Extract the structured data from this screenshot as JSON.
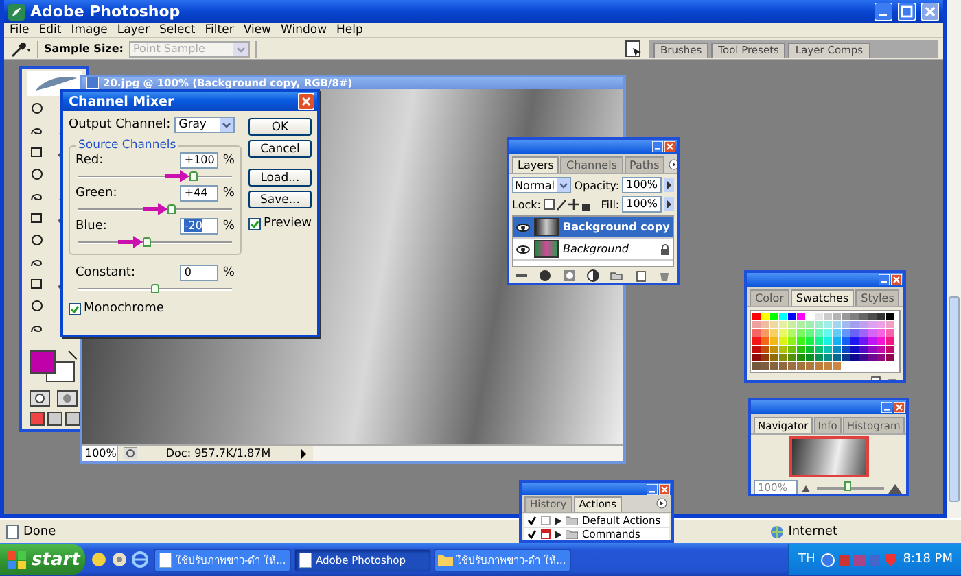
{
  "window": {
    "title": "Adobe Photoshop"
  },
  "menu": [
    "File",
    "Edit",
    "Image",
    "Layer",
    "Select",
    "Filter",
    "View",
    "Window",
    "Help"
  ],
  "options_bar": {
    "sample_size_label": "Sample Size:",
    "sample_size": {
      "value": "Point Sample",
      "disabled": true
    },
    "palette_well_tabs": [
      "Brushes",
      "Tool Presets",
      "Layer Comps"
    ]
  },
  "document": {
    "title": "20.jpg @ 100% (Background copy, RGB/8#)",
    "zoom": "100%",
    "doc_info": "Doc: 957.7K/1.87M"
  },
  "channel_mixer": {
    "title": "Channel Mixer",
    "output_channel_label": "Output Channel:",
    "output_channel": "Gray",
    "group_label": "Source Channels",
    "channels": [
      {
        "name": "Red:",
        "value": "+100",
        "unit": "%",
        "level": 0.75,
        "selected": false
      },
      {
        "name": "Green:",
        "value": "+44",
        "unit": "%",
        "level": 0.61,
        "selected": false
      },
      {
        "name": "Blue:",
        "value": "-20",
        "unit": "%",
        "level": 0.45,
        "selected": true
      }
    ],
    "constant": {
      "name": "Constant:",
      "value": "0",
      "unit": "%",
      "level": 0.5
    },
    "buttons": [
      "OK",
      "Cancel",
      "Load...",
      "Save..."
    ],
    "preview": {
      "label": "Preview",
      "checked": true
    },
    "monochrome": {
      "label": "Monochrome",
      "checked": true
    }
  },
  "layers_palette": {
    "tabs": [
      {
        "label": "Layers",
        "selected": true
      },
      {
        "label": "Channels",
        "selected": false
      },
      {
        "label": "Paths",
        "selected": false
      }
    ],
    "blend_mode": "Normal",
    "opacity_label": "Opacity:",
    "opacity": "100%",
    "lock_label": "Lock:",
    "fill_label": "Fill:",
    "fill": "100%",
    "layers": [
      {
        "name": "Background copy",
        "selected": true,
        "visible": true,
        "locked": false
      },
      {
        "name": "Background",
        "selected": false,
        "visible": true,
        "locked": true
      }
    ]
  },
  "swatches_palette": {
    "tabs": [
      {
        "label": "Color",
        "selected": false
      },
      {
        "label": "Swatches",
        "selected": true
      },
      {
        "label": "Styles",
        "selected": false
      }
    ]
  },
  "navigator_palette": {
    "tabs": [
      {
        "label": "Navigator",
        "selected": true
      },
      {
        "label": "Info",
        "selected": false
      },
      {
        "label": "Histogram",
        "selected": false
      }
    ],
    "zoom": "100%",
    "zoom_slider": {
      "level": 0.45
    }
  },
  "actions_palette": {
    "tabs": [
      {
        "label": "History",
        "selected": false
      },
      {
        "label": "Actions",
        "selected": true
      }
    ],
    "actions": [
      {
        "name": "Default Actions",
        "checked": true,
        "dialog": false
      },
      {
        "name": "Commands",
        "checked": true,
        "dialog": true
      }
    ]
  },
  "browser_status": {
    "left": "Done",
    "right": "Internet"
  },
  "taskbar": {
    "start": "start",
    "tasks": [
      {
        "label": "ใช้ปรับภาพขาว-ดำ ให้...",
        "selected": false
      },
      {
        "label": "Adobe Photoshop",
        "selected": true
      },
      {
        "label": "ใช้ปรับภาพขาว-ดำ ให้...",
        "selected": false
      }
    ],
    "language": "TH",
    "clock": "8:18 PM"
  }
}
